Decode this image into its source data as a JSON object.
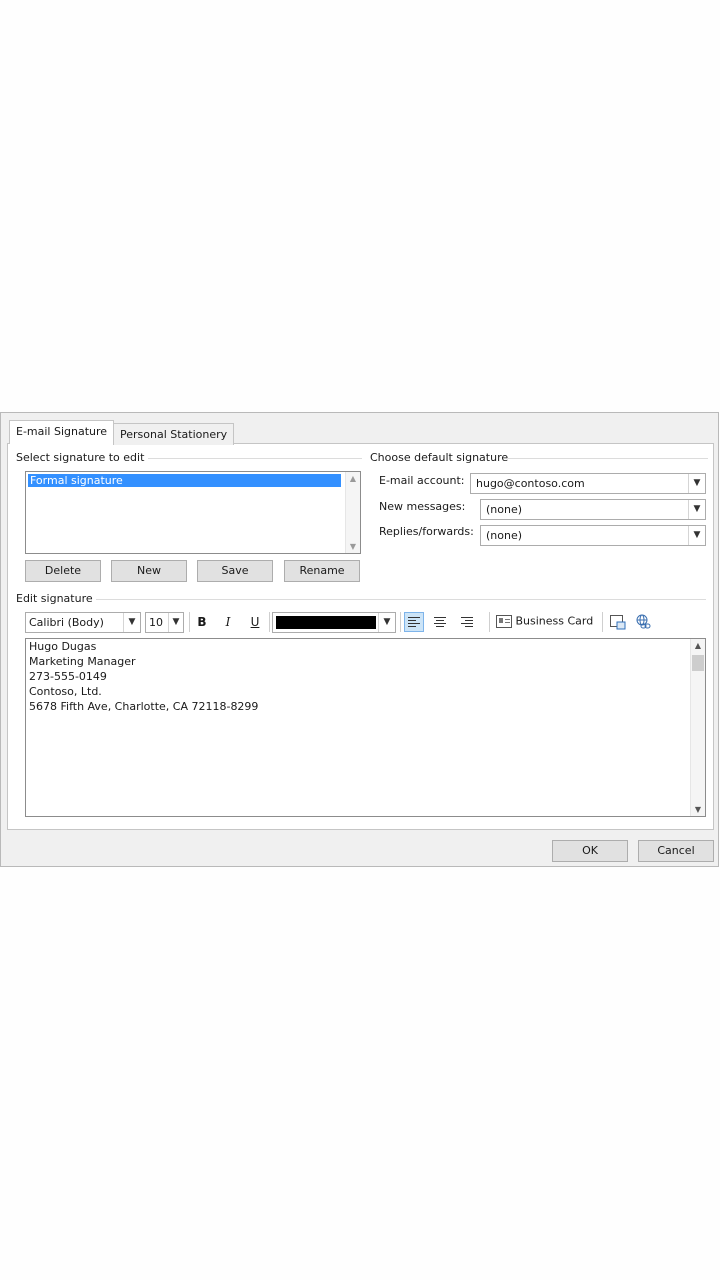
{
  "tabs": {
    "email_signature": "E-mail Signature",
    "personal_stationery": "Personal Stationery"
  },
  "select_signature": {
    "title": "Select signature to edit",
    "items": [
      "Formal signature"
    ]
  },
  "buttons": {
    "delete": "Delete",
    "new": "New",
    "save": "Save",
    "rename": "Rename"
  },
  "default_signature": {
    "title": "Choose default signature",
    "email_account_label": "E-mail account:",
    "email_account_value": "hugo@contoso.com",
    "new_messages_label": "New messages:",
    "new_messages_value": "(none)",
    "replies_label": "Replies/forwards:",
    "replies_value": "(none)"
  },
  "edit_signature": {
    "title": "Edit signature",
    "font": "Calibri (Body)",
    "size": "10",
    "bold": "B",
    "italic": "I",
    "underline": "U",
    "business_card": "Business Card",
    "text_color": "#000000",
    "lines": [
      "Hugo Dugas",
      "Marketing Manager",
      "273-555-0149",
      "Contoso, Ltd.",
      "5678 Fifth Ave, Charlotte, CA 72118-8299"
    ]
  },
  "footer": {
    "ok": "OK",
    "cancel": "Cancel"
  }
}
